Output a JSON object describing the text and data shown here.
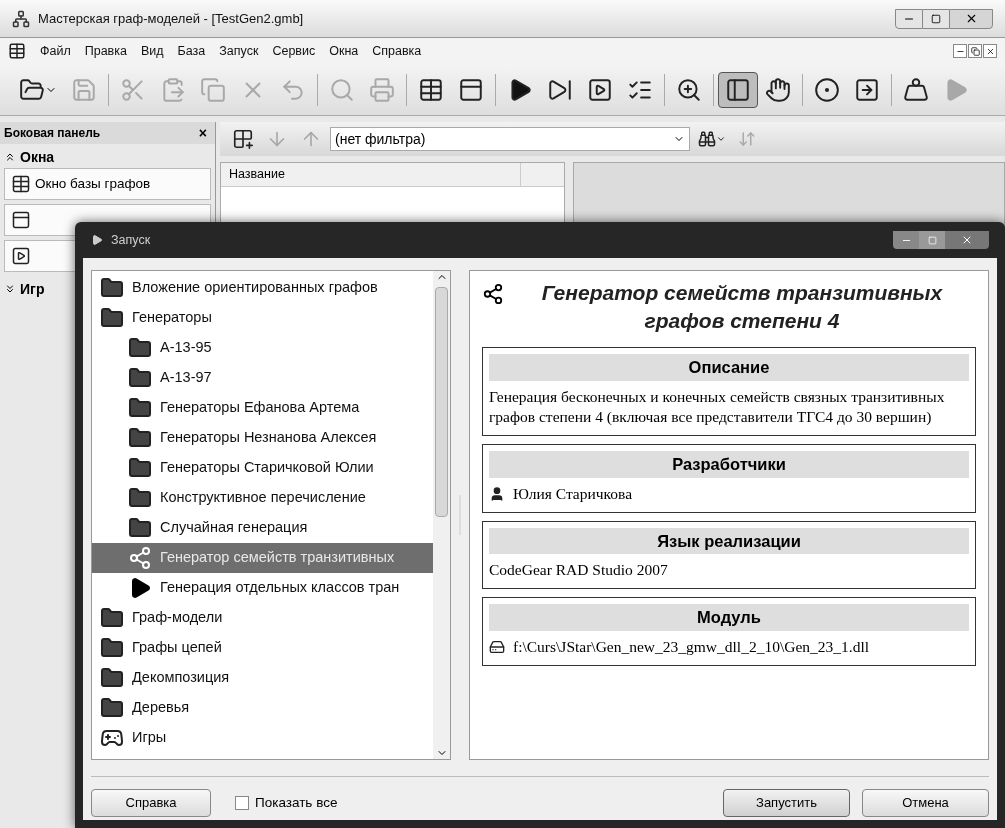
{
  "window": {
    "title": "Мастерская граф-моделей - [TestGen2.gmb]"
  },
  "menu": [
    "Файл",
    "Правка",
    "Вид",
    "База",
    "Запуск",
    "Сервис",
    "Окна",
    "Справка"
  ],
  "toolbar": [
    {
      "kind": "open",
      "disabled": false,
      "pressed": false
    },
    {
      "kind": "save",
      "disabled": true,
      "pressed": false
    },
    {
      "kind": "sep"
    },
    {
      "kind": "cut",
      "disabled": true,
      "pressed": false
    },
    {
      "kind": "paste",
      "disabled": true,
      "pressed": false
    },
    {
      "kind": "copy",
      "disabled": true,
      "pressed": false
    },
    {
      "kind": "delete",
      "disabled": true,
      "pressed": false
    },
    {
      "kind": "undo",
      "disabled": true,
      "pressed": false
    },
    {
      "kind": "sep"
    },
    {
      "kind": "find",
      "disabled": true,
      "pressed": false
    },
    {
      "kind": "print",
      "disabled": true,
      "pressed": false
    },
    {
      "kind": "sep"
    },
    {
      "kind": "table",
      "disabled": false,
      "pressed": false
    },
    {
      "kind": "window",
      "disabled": false,
      "pressed": false
    },
    {
      "kind": "sep"
    },
    {
      "kind": "run",
      "disabled": false,
      "pressed": false
    },
    {
      "kind": "step",
      "disabled": false,
      "pressed": false
    },
    {
      "kind": "frame",
      "disabled": false,
      "pressed": false
    },
    {
      "kind": "checklist",
      "disabled": false,
      "pressed": false
    },
    {
      "kind": "sep"
    },
    {
      "kind": "zoom",
      "disabled": false,
      "pressed": false
    },
    {
      "kind": "sep"
    },
    {
      "kind": "panel",
      "disabled": false,
      "pressed": true
    },
    {
      "kind": "hand",
      "disabled": false,
      "pressed": false
    },
    {
      "kind": "sep"
    },
    {
      "kind": "target",
      "disabled": false,
      "pressed": false
    },
    {
      "kind": "export",
      "disabled": false,
      "pressed": false
    },
    {
      "kind": "sep"
    },
    {
      "kind": "weight",
      "disabled": false,
      "pressed": false
    },
    {
      "kind": "run",
      "disabled": true,
      "pressed": false
    }
  ],
  "sidebar": {
    "title": "Боковая панель",
    "close": "×",
    "sections": [
      {
        "title": "Окна",
        "expanded": true,
        "items": [
          {
            "kind": "table",
            "label": "Окно базы графов"
          },
          {
            "kind": "window"
          },
          {
            "kind": "frame"
          }
        ]
      },
      {
        "title": "Игр",
        "expanded": false
      }
    ]
  },
  "list_toolbar": {
    "filter": "(нет фильтра)",
    "buttons": [
      {
        "kind": "add",
        "disabled": false
      },
      {
        "kind": "down",
        "disabled": true
      },
      {
        "kind": "up",
        "disabled": true
      }
    ],
    "search_disabled": false,
    "sort_disabled": true
  },
  "table": {
    "columns": [
      "Название"
    ]
  },
  "dialog": {
    "title": "Запуск",
    "tree": [
      {
        "kind": "folder",
        "label": "Вложение ориентированных графов",
        "selected": false
      },
      {
        "kind": "folder",
        "label": "Генераторы",
        "selected": false,
        "children": [
          {
            "kind": "folder",
            "label": "A-13-95",
            "selected": false
          },
          {
            "kind": "folder",
            "label": "A-13-97",
            "selected": false
          },
          {
            "kind": "folder",
            "label": "Генераторы Ефанова Артема",
            "selected": false
          },
          {
            "kind": "folder",
            "label": "Генераторы Незнанова Алексея",
            "selected": false
          },
          {
            "kind": "folder",
            "label": "Генераторы Старичковой Юлии",
            "selected": false
          },
          {
            "kind": "folder",
            "label": "Конструктивное перечисление",
            "selected": false
          },
          {
            "kind": "folder",
            "label": "Случайная генерация",
            "selected": false
          },
          {
            "kind": "generator",
            "label": "Генератор семейств транзитивных",
            "selected": true
          },
          {
            "kind": "run",
            "label": "Генерация отдельных классов тран",
            "selected": false
          }
        ]
      },
      {
        "kind": "folder",
        "label": "Граф-модели",
        "selected": false
      },
      {
        "kind": "folder",
        "label": "Графы цепей",
        "selected": false
      },
      {
        "kind": "folder",
        "label": "Декомпозиция",
        "selected": false
      },
      {
        "kind": "folder",
        "label": "Деревья",
        "selected": false
      },
      {
        "kind": "game",
        "label": "Игры",
        "selected": false
      }
    ],
    "heading": "Генератор семейств транзитивных графов степени 4",
    "sections": [
      {
        "kind": "text",
        "title": "Описание",
        "text": "Генерация бесконечных и конечных семейств связных транзитивных графов степени 4 (включая все представители ТГС4 до 30 вершин)"
      },
      {
        "kind": "person",
        "title": "Разработчики",
        "text": "Юлия Старичкова"
      },
      {
        "kind": "text",
        "title": "Язык реализации",
        "text": "CodeGear RAD Studio 2007"
      },
      {
        "kind": "file",
        "title": "Модуль",
        "text": "f:\\Curs\\JStar\\Gen_new_23_gmw_dll_2_10\\Gen_23_1.dll"
      }
    ],
    "help_button": "Справка",
    "show_all": {
      "label": "Показать все",
      "checked": false
    },
    "run_button": "Запустить",
    "cancel_button": "Отмена"
  }
}
